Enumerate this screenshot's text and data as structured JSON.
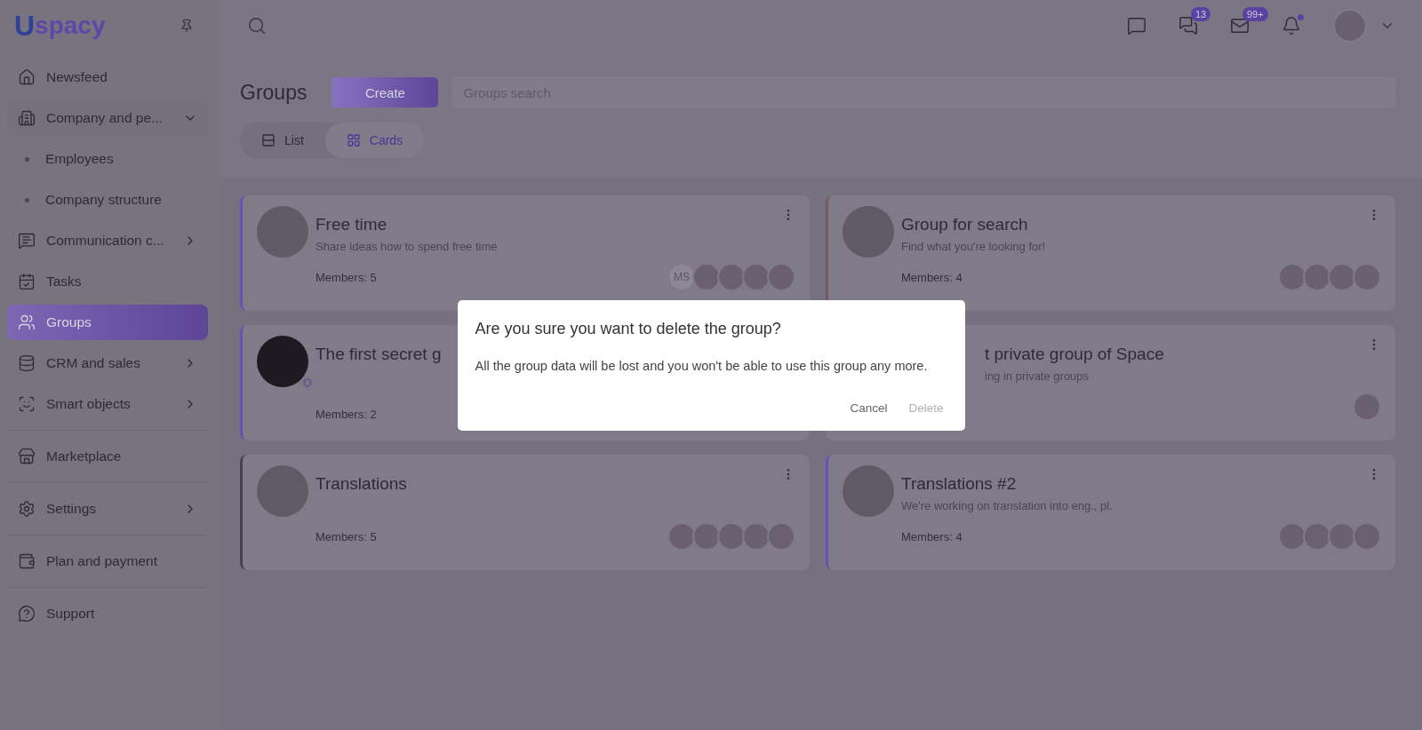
{
  "sidebar": {
    "logo": {
      "letter": "U",
      "word": "spacy"
    },
    "sections": [
      [
        {
          "label": "Newsfeed",
          "selected": false
        },
        {
          "label": "Company and pe...",
          "selected": false,
          "expanded": true,
          "children": [
            {
              "label": "Employees",
              "selected": false
            },
            {
              "label": "Company structure",
              "selected": false
            }
          ]
        },
        {
          "label": "Communication c...",
          "selected": false,
          "expanded": false
        },
        {
          "label": "Tasks",
          "selected": false
        },
        {
          "label": "Groups",
          "selected": true
        },
        {
          "label": "CRM and sales",
          "selected": false,
          "expanded": false
        },
        {
          "label": "Smart objects",
          "selected": false,
          "expanded": false
        }
      ],
      [
        {
          "label": "Marketplace",
          "selected": false
        }
      ],
      [
        {
          "label": "Settings",
          "selected": false,
          "expanded": false
        }
      ],
      [
        {
          "label": "Plan and payment",
          "selected": false
        }
      ],
      [
        {
          "label": "Support",
          "selected": false
        }
      ]
    ]
  },
  "topbar": {
    "icons": [
      {
        "kind": "chat"
      },
      {
        "kind": "chats",
        "badge": "13"
      },
      {
        "kind": "mail",
        "badge": "99+"
      },
      {
        "kind": "bell"
      }
    ]
  },
  "page": {
    "title": "Groups",
    "create_button": "Create",
    "search": {
      "placeholder": "Groups search"
    },
    "views": [
      {
        "label": "List",
        "selected": false
      },
      {
        "label": "Cards",
        "selected": true
      }
    ]
  },
  "cards": [
    {
      "kind": "full",
      "title": "Free time",
      "description": "Share ideas how to spend free time",
      "members": "Members: 5",
      "color": "#6b4fb8",
      "avatars": [
        {
          "kind": "initials",
          "text": "MS"
        },
        {
          "kind": "photo"
        },
        {
          "kind": "photo"
        },
        {
          "kind": "photo"
        },
        {
          "kind": "photo"
        }
      ]
    },
    {
      "kind": "full",
      "title": "Group for search",
      "description": "Find what you're looking for!",
      "members": "Members: 4",
      "color": "#7a5a5e",
      "avatars": [
        {
          "kind": "photo"
        },
        {
          "kind": "photo"
        },
        {
          "kind": "photo"
        },
        {
          "kind": "photo"
        }
      ]
    },
    {
      "kind": "secret",
      "title": "The first secret g",
      "members": "Members: 2",
      "color": "#6b4fb8"
    },
    {
      "kind": "obscured",
      "title": "t private group of Space",
      "description": "ing in private groups",
      "avatars": [
        {
          "kind": "photo"
        }
      ]
    },
    {
      "kind": "full",
      "title": "Translations",
      "members": "Members: 5",
      "color": "#45414d",
      "avatars": [
        {
          "kind": "photo"
        },
        {
          "kind": "photo"
        },
        {
          "kind": "photo"
        },
        {
          "kind": "photo"
        },
        {
          "kind": "photo"
        }
      ]
    },
    {
      "kind": "full",
      "title": "Translations #2",
      "description": "We're working on translation into eng., pl.",
      "members": "Members: 4",
      "color": "#6b4fb8",
      "avatars": [
        {
          "kind": "photo"
        },
        {
          "kind": "photo"
        },
        {
          "kind": "photo"
        },
        {
          "kind": "photo"
        }
      ]
    }
  ],
  "dialog": {
    "title": "Are you sure you want to delete the group?",
    "message": "All the group data will be lost and you won't be able to use this group any more.",
    "buttons": [
      {
        "label": "Cancel",
        "disabled": false
      },
      {
        "label": "Delete",
        "disabled": true
      }
    ]
  }
}
